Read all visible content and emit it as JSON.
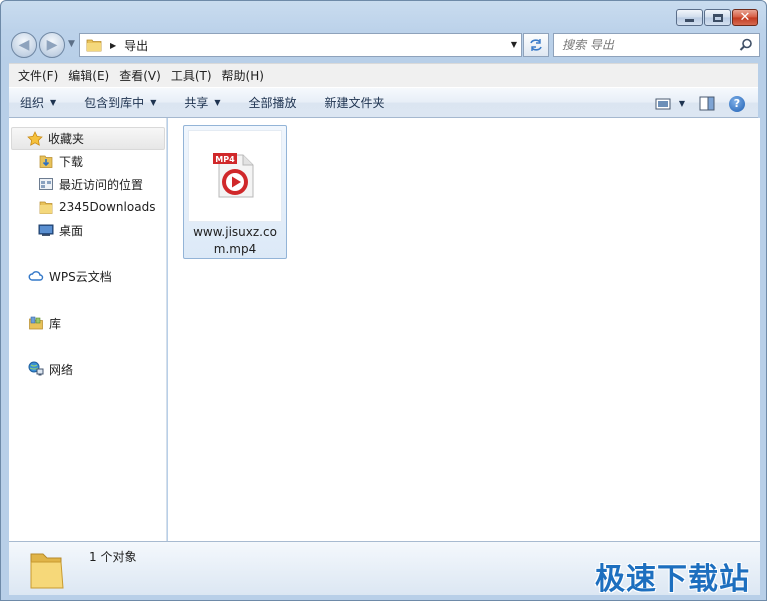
{
  "window": {
    "address_path": "导出",
    "search_placeholder": "搜索 导出"
  },
  "menu": {
    "items": [
      "文件(F)",
      "编辑(E)",
      "查看(V)",
      "工具(T)",
      "帮助(H)"
    ]
  },
  "toolbar": {
    "organize": "组织",
    "include_library": "包含到库中",
    "share": "共享",
    "play_all": "全部播放",
    "new_folder": "新建文件夹",
    "help": "?"
  },
  "nav": {
    "favorites": "收藏夹",
    "downloads": "下载",
    "recent": "最近访问的位置",
    "downloads2345": "2345Downloads",
    "desktop": "桌面",
    "wps_cloud": "WPS云文档",
    "libraries": "库",
    "network": "网络"
  },
  "files": [
    {
      "name": "www.jisuxz.com.mp4",
      "badge": "MP4",
      "icon": "mp4-video-icon"
    }
  ],
  "status": {
    "count_text": "1 个对象",
    "watermark": "极速下载站"
  },
  "colors": {
    "accent": "#1d6fbf",
    "mp4_red": "#d0282a"
  }
}
